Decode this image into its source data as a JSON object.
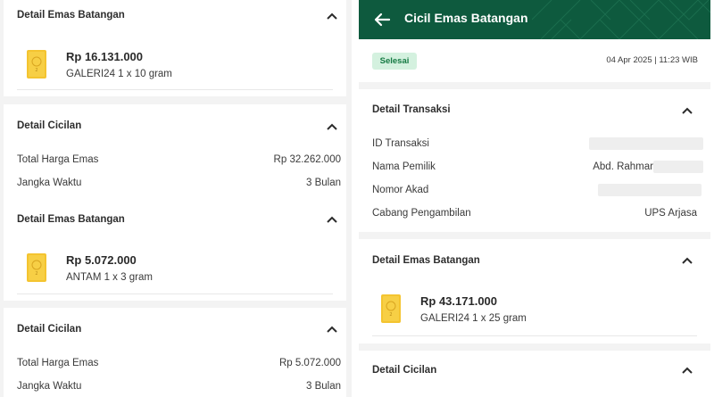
{
  "left": {
    "sections": [
      {
        "title": "Detail Emas Batangan",
        "price": "Rp 16.131.000",
        "item": "GALERI24  1 x 10 gram"
      },
      {
        "title": "Detail Cicilan",
        "rows": [
          {
            "label": "Total Harga Emas",
            "value": "Rp 32.262.000"
          },
          {
            "label": "Jangka Waktu",
            "value": "3 Bulan"
          }
        ]
      },
      {
        "title": "Detail Emas Batangan",
        "price": "Rp 5.072.000",
        "item": "ANTAM  1 x 3 gram"
      },
      {
        "title": "Detail Cicilan",
        "rows": [
          {
            "label": "Total Harga Emas",
            "value": "Rp 5.072.000"
          },
          {
            "label": "Jangka Waktu",
            "value": "3 Bulan"
          }
        ]
      }
    ]
  },
  "right": {
    "header": {
      "title": "Cicil Emas Batangan"
    },
    "status": {
      "label": "Selesai",
      "datetime": "04 Apr 2025 | 11:23 WIB"
    },
    "transaksi": {
      "title": "Detail Transaksi",
      "rows": [
        {
          "label": "ID Transaksi",
          "value": ""
        },
        {
          "label": "Nama Pemilik",
          "value": "Abd. Rahmar"
        },
        {
          "label": "Nomor Akad",
          "value": ""
        },
        {
          "label": "Cabang Pengambilan",
          "value": "UPS Arjasa"
        }
      ]
    },
    "emas": {
      "title": "Detail Emas Batangan",
      "price": "Rp 43.171.000",
      "item": "GALERI24  1 x 25 gram"
    },
    "cicilan": {
      "title": "Detail Cicilan"
    }
  },
  "colors": {
    "header_green": "#0e5a3e",
    "badge_bg": "#d4f1df",
    "badge_text": "#157a43",
    "gold": "#f4c430"
  },
  "icons": {
    "chevron": "chevron-up-icon",
    "back": "arrow-left-icon",
    "gold": "gold-bar-icon"
  }
}
